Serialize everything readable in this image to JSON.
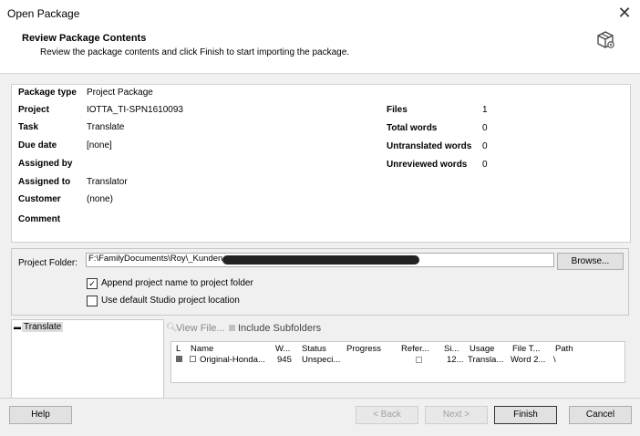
{
  "window": {
    "title": "Open Package"
  },
  "header": {
    "title": "Review Package Contents",
    "subtitle": "Review the package contents and click Finish to start importing the package.",
    "icon": "package-icon"
  },
  "details": {
    "package_type": {
      "label": "Package type",
      "value": "Project Package"
    },
    "project": {
      "label": "Project",
      "value": "IOTTA_TI-SPN1610093"
    },
    "task": {
      "label": "Task",
      "value": "Translate"
    },
    "due_date": {
      "label": "Due date",
      "value": "[none]"
    },
    "assigned_by": {
      "label": "Assigned by",
      "value": ""
    },
    "assigned_to": {
      "label": "Assigned to",
      "value": "Translator"
    },
    "customer": {
      "label": "Customer",
      "value": "(none)"
    },
    "comment": {
      "label": "Comment",
      "value": ""
    }
  },
  "stats": {
    "files": {
      "label": "Files",
      "value": "1"
    },
    "total_words": {
      "label": "Total words",
      "value": "0"
    },
    "untranslated_words": {
      "label": "Untranslated words",
      "value": "0"
    },
    "unreviewed_words": {
      "label": "Unreviewed words",
      "value": "0"
    }
  },
  "project_folder": {
    "label": "Project Folder:",
    "path": "F:\\FamilyDocuments\\Roy\\_Kunden",
    "browse_label": "Browse...",
    "append_label": "Append project name to project folder",
    "append_checked": true,
    "default_label": "Use default Studio project location",
    "default_checked": false
  },
  "tree": {
    "items": [
      {
        "label": "Translate"
      }
    ]
  },
  "files_toolbar": {
    "view_file": "View File...",
    "include_subfolders": "Include Subfolders"
  },
  "files_table": {
    "columns": [
      "L",
      "Name",
      "W...",
      "Status",
      "Progress",
      "Refer...",
      "Si...",
      "Usage",
      "File T...",
      "Path"
    ],
    "rows": [
      {
        "name": "Original-Honda...",
        "words": "945",
        "status": "Unspeci...",
        "size": "12...",
        "usage": "Transla...",
        "file_type": "Word 2...",
        "path": "\\"
      }
    ]
  },
  "buttons": {
    "help": "Help",
    "back": "< Back",
    "next": "Next >",
    "finish": "Finish",
    "cancel": "Cancel"
  }
}
